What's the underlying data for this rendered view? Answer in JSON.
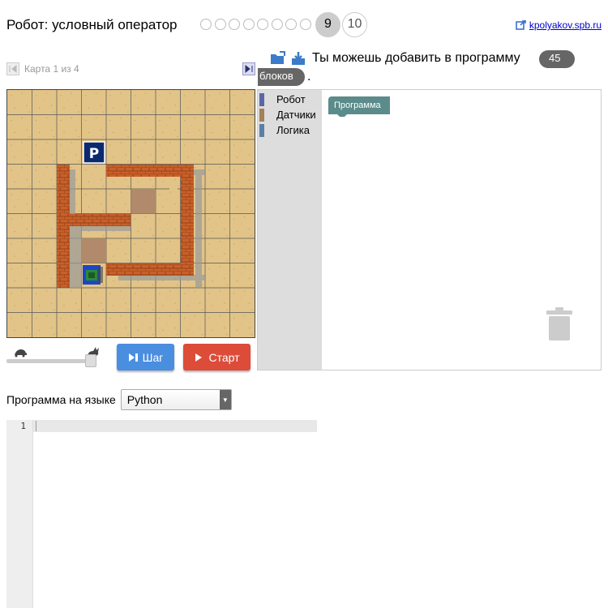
{
  "header": {
    "title": "Робот: условный оператор",
    "levels": [
      "9",
      "10"
    ],
    "link": "kpolyakov.spb.ru"
  },
  "map": {
    "label": "Карта 1 из 4",
    "parking_label": "P"
  },
  "controls": {
    "step_label": "Шаг",
    "start_label": "Старт"
  },
  "blocks": {
    "prefix": "Ты можешь добавить в программу",
    "count": "45",
    "word": "блоков",
    "suffix": "."
  },
  "toolbox": {
    "categories": [
      {
        "label": "Робот",
        "color": "#5b67a5"
      },
      {
        "label": "Датчики",
        "color": "#a5805b"
      },
      {
        "label": "Логика",
        "color": "#5b80a5"
      }
    ]
  },
  "workspace": {
    "program_block": "Программа"
  },
  "language": {
    "label": "Программа на языке",
    "selected": "Python"
  },
  "editor": {
    "line_number": "1"
  },
  "colors": {
    "step": "#4a8ee0",
    "start": "#dd4b39",
    "brick": "#c8602a",
    "sand": "#e2c488"
  }
}
